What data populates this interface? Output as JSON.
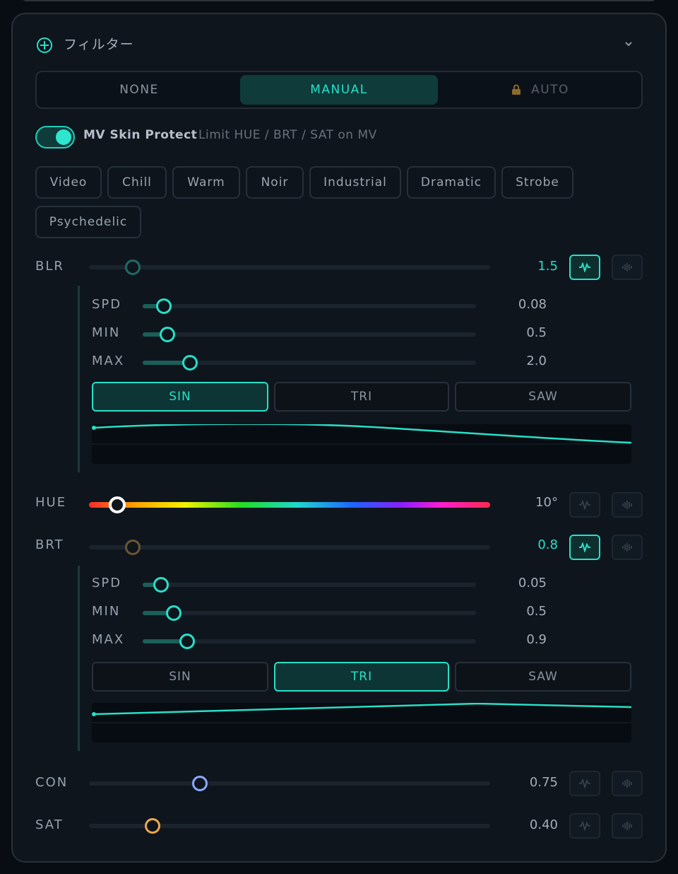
{
  "header": {
    "title": "フィルター"
  },
  "modes": [
    {
      "label": "NONE",
      "active": false
    },
    {
      "label": "MANUAL",
      "active": true
    },
    {
      "label": "AUTO",
      "active": false,
      "locked": true
    }
  ],
  "skin_protect": {
    "enabled": true,
    "label": "MV Skin Protect",
    "description": "Limit HUE / BRT / SAT on MV"
  },
  "presets": [
    "Video",
    "Chill",
    "Warm",
    "Noir",
    "Industrial",
    "Dramatic",
    "Strobe",
    "Psychedelic"
  ],
  "params": {
    "blr": {
      "label": "BLR",
      "value": "1.5",
      "level": 0.09,
      "lfo_active": true,
      "lfo": {
        "spd": {
          "label": "SPD",
          "value": "0.08",
          "level": 0.04
        },
        "min": {
          "label": "MIN",
          "value": "0.5",
          "level": 0.05
        },
        "max": {
          "label": "MAX",
          "value": "2.0",
          "level": 0.12
        },
        "waves": [
          "SIN",
          "TRI",
          "SAW"
        ],
        "wave_selected": "SIN"
      }
    },
    "hue": {
      "label": "HUE",
      "value": "10°",
      "level": 0.05
    },
    "brt": {
      "label": "BRT",
      "value": "0.8",
      "level": 0.09,
      "lfo_active": true,
      "lfo": {
        "spd": {
          "label": "SPD",
          "value": "0.05",
          "level": 0.03
        },
        "min": {
          "label": "MIN",
          "value": "0.5",
          "level": 0.07
        },
        "max": {
          "label": "MAX",
          "value": "0.9",
          "level": 0.11
        },
        "waves": [
          "SIN",
          "TRI",
          "SAW"
        ],
        "wave_selected": "TRI"
      }
    },
    "con": {
      "label": "CON",
      "value": "0.75",
      "level": 0.26
    },
    "sat": {
      "label": "SAT",
      "value": "0.40",
      "level": 0.14
    }
  },
  "icons": {
    "expand": "chevron-down-icon",
    "add": "plus-circle-icon",
    "lfo": "wave-icon",
    "audio": "audio-bars-icon",
    "lock": "lock-icon"
  },
  "colors": {
    "accent": "#27e0c7",
    "con_thumb": "#8aa8ff",
    "sat_thumb": "#f0a84a",
    "brt_thumb": "#6b5630"
  }
}
